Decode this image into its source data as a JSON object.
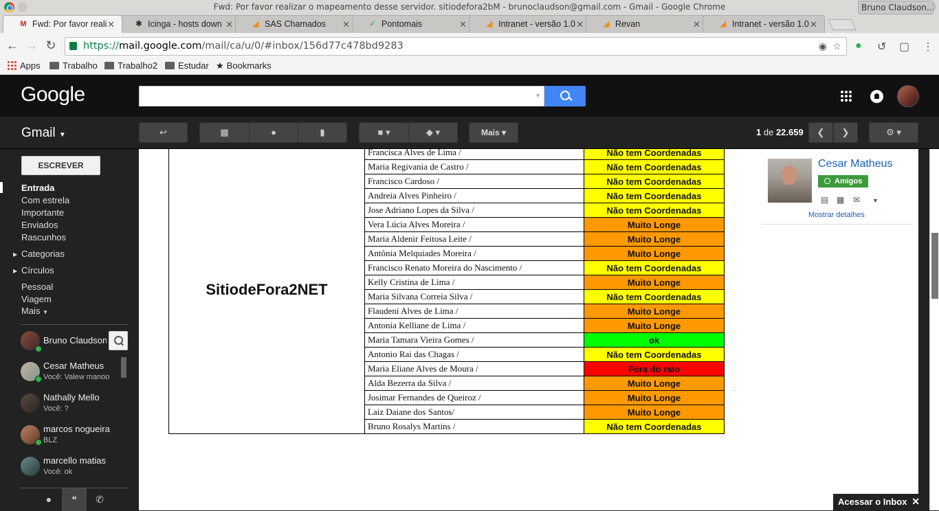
{
  "browser": {
    "window_title": "Fwd: Por favor realizar o mapeamento desse servidor. sitiodefora2bM - brunoclaudson@gmail.com - Gmail - Google Chrome",
    "tabs": [
      {
        "label": "Fwd: Por favor reali",
        "icon": "gmail-icon"
      },
      {
        "label": "Icinga - hosts down",
        "icon": "icinga-icon"
      },
      {
        "label": "SAS Chamados",
        "icon": "sas-icon"
      },
      {
        "label": "Pontomais",
        "icon": "pontomais-icon"
      },
      {
        "label": "Intranet - versão 1.0",
        "icon": "intranet-icon"
      },
      {
        "label": "Revan",
        "icon": "revan-icon"
      },
      {
        "label": "Intranet - versão 1.0",
        "icon": "intranet-icon"
      }
    ],
    "profile": "Bruno Claudson...",
    "url_scheme": "https://",
    "url_host": "mail.google.com",
    "url_path": "/mail/ca/u/0/#inbox/156d77c478bd9283",
    "bookmarks": [
      "Apps",
      "Trabalho",
      "Trabalho2",
      "Estudar",
      "Bookmarks"
    ]
  },
  "gmail": {
    "logo": "Google",
    "app_label": "Gmail",
    "more_label": "Mais",
    "pager": {
      "range": "1",
      "of": "de",
      "total": "22.659"
    },
    "compose_label": "ESCREVER",
    "nav": [
      "Entrada",
      "Com estrela",
      "Importante",
      "Enviados",
      "Rascunhos"
    ],
    "nav_groups": [
      "Categorias",
      "Círculos"
    ],
    "labels": [
      "Pessoal",
      "Viagem",
      "Mais"
    ],
    "chat": {
      "me": "Bruno Claudson",
      "contacts": [
        {
          "name": "Cesar Matheus",
          "status": "Você: Valew manoo"
        },
        {
          "name": "Nathally Mello",
          "status": "Você: ?"
        },
        {
          "name": "marcos nogueira",
          "status": "BLZ"
        },
        {
          "name": "marcello matias",
          "status": "Você: ok"
        }
      ]
    },
    "contact_card": {
      "name": "Cesar Matheus",
      "circle": "Amigos",
      "show_details": "Mostrar detalhes"
    },
    "inbox_promo": "Acessar o Inbox"
  },
  "report": {
    "site": "SitiodeFora2NET",
    "rows": [
      {
        "name": "Francisca Alves de Lima /",
        "status": "Não tem Coordenadas",
        "level": "yellow"
      },
      {
        "name": "Maria Regivania de Castro /",
        "status": "Não tem Coordenadas",
        "level": "yellow"
      },
      {
        "name": "Francisco Cardoso /",
        "status": "Não tem Coordenadas",
        "level": "yellow"
      },
      {
        "name": "Andreia Alves Pinheiro /",
        "status": "Não tem Coordenadas",
        "level": "yellow"
      },
      {
        "name": "Jose Adriano Lopes da Silva /",
        "status": "Não tem Coordenadas",
        "level": "yellow"
      },
      {
        "name": "Vera Lúcia Alves Moreira /",
        "status": "Muito Longe",
        "level": "orange"
      },
      {
        "name": "Maria Aldenir Feitosa Leite /",
        "status": "Muito Longe",
        "level": "orange"
      },
      {
        "name": "Antônia Melquiades Moreira /",
        "status": "Muito Longe",
        "level": "orange"
      },
      {
        "name": "Francisco Renato Moreira do Nascimento /",
        "status": "Não tem Coordenadas",
        "level": "yellow"
      },
      {
        "name": "Kelly Cristina de Lima /",
        "status": "Muito Longe",
        "level": "orange"
      },
      {
        "name": "Maria Silvana Correia Silva /",
        "status": "Não tem Coordenadas",
        "level": "yellow"
      },
      {
        "name": "Flaudeni Alves de Lima /",
        "status": "Muito Longe",
        "level": "orange"
      },
      {
        "name": "Antonia Kelliane de Lima /",
        "status": "Muito Longe",
        "level": "orange"
      },
      {
        "name": "Maria Tamara Vieira Gomes /",
        "status": "ok",
        "level": "green"
      },
      {
        "name": "Antonio Rai das Chagas /",
        "status": "Não tem Coordenadas",
        "level": "yellow"
      },
      {
        "name": "Maria Eliane Alves de Moura /",
        "status": "Fora do raio",
        "level": "red"
      },
      {
        "name": "Alda Bezerra da Silva /",
        "status": "Muito Longe",
        "level": "orange"
      },
      {
        "name": "Josimar Fernandes de Queiroz /",
        "status": "Muito Longe",
        "level": "orange"
      },
      {
        "name": "Laiz Daiane dos Santos/",
        "status": "Muito Longe",
        "level": "orange"
      },
      {
        "name": "Bruno Rosalys Martins /",
        "status": "Não tem Coordenadas",
        "level": "yellow"
      }
    ],
    "colors": {
      "yellow": "#ffff00",
      "orange": "#ff9900",
      "green": "#00ff00",
      "red": "#ff0000"
    }
  }
}
